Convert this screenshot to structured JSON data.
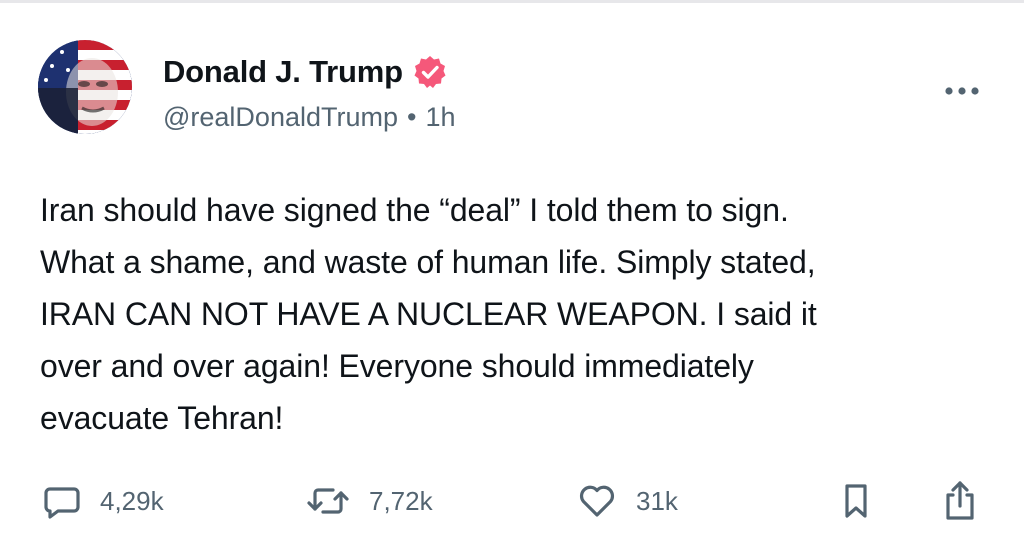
{
  "post": {
    "author": {
      "display_name": "Donald J. Trump",
      "handle": "@realDonaldTrump",
      "separator": "•",
      "time": "1h",
      "verified_icon": "verified-badge-icon",
      "verified_color": "#f5587a"
    },
    "body_lines": [
      "Iran should have signed the “deal” I told them to sign.",
      "What a shame, and waste of human life. Simply stated,",
      "IRAN CAN NOT HAVE A NUCLEAR WEAPON. I said it",
      "over and over again! Everyone should immediately",
      "evacuate Tehran!"
    ],
    "actions": {
      "reply_count": "4,29k",
      "repost_count": "7,72k",
      "like_count": "31k"
    }
  },
  "colors": {
    "text": "#0f1419",
    "secondary": "#536471",
    "icon": "#536471"
  }
}
